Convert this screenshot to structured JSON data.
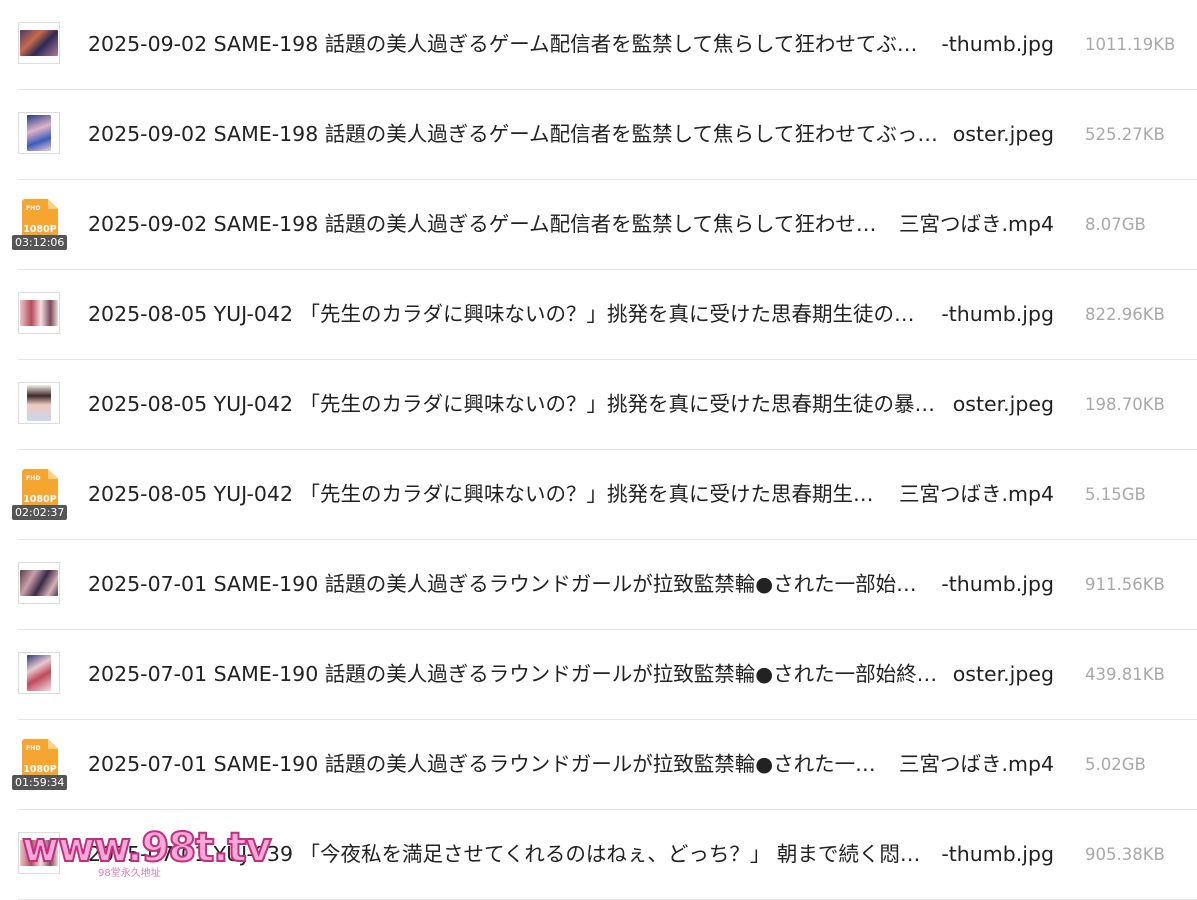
{
  "files": [
    {
      "type": "image",
      "thumb": "a",
      "name": "2025-09-02 SAME-198 話題の美人過ぎるゲーム配信者を監禁して焦らして狂わせてぶ…",
      "suffix": "-thumb.jpg",
      "size": "1011.19KB"
    },
    {
      "type": "image",
      "thumb": "b",
      "name": "2025-09-02 SAME-198 話題の美人過ぎるゲーム配信者を監禁して焦らして狂わせてぶっ…",
      "suffix": "oster.jpeg",
      "size": "525.27KB"
    },
    {
      "type": "video",
      "res": "1080P",
      "fhd": "FHD",
      "duration": "03:12:06",
      "name": "2025-09-02 SAME-198 話題の美人過ぎるゲーム配信者を監禁して焦らして狂わせ…",
      "suffix": "三宮つばき.mp4",
      "size": "8.07GB"
    },
    {
      "type": "image",
      "thumb": "c",
      "name": "2025-08-05 YUJ-042 「先生のカラダに興味ないの？」挑発を真に受けた思春期生徒の…",
      "suffix": "-thumb.jpg",
      "size": "822.96KB"
    },
    {
      "type": "image",
      "thumb": "d",
      "name": "2025-08-05 YUJ-042 「先生のカラダに興味ないの？」挑発を真に受けた思春期生徒の暴…",
      "suffix": "oster.jpeg",
      "size": "198.70KB"
    },
    {
      "type": "video",
      "res": "1080P",
      "fhd": "FHD",
      "duration": "02:02:37",
      "name": "2025-08-05 YUJ-042 「先生のカラダに興味ないの？」挑発を真に受けた思春期生…",
      "suffix": "三宮つばき.mp4",
      "size": "5.15GB"
    },
    {
      "type": "image",
      "thumb": "e",
      "name": "2025-07-01 SAME-190 話題の美人過ぎるラウンドガールが拉致監禁輪●された一部始…",
      "suffix": "-thumb.jpg",
      "size": "911.56KB"
    },
    {
      "type": "image",
      "thumb": "f",
      "name": "2025-07-01 SAME-190 話題の美人過ぎるラウンドガールが拉致監禁輪●された一部始終…",
      "suffix": "oster.jpeg",
      "size": "439.81KB"
    },
    {
      "type": "video",
      "res": "1080P",
      "fhd": "FHD",
      "duration": "01:59:34",
      "name": "2025-07-01 SAME-190 話題の美人過ぎるラウンドガールが拉致監禁輪●された一…",
      "suffix": "三宮つばき.mp4",
      "size": "5.02GB"
    },
    {
      "type": "image",
      "thumb": "c",
      "name": "2025-07-01 YUJ-039 「今夜私を満足させてくれるのはねぇ、どっち？」 朝まで続く悶…",
      "suffix": "-thumb.jpg",
      "size": "905.38KB"
    }
  ],
  "watermark": {
    "text": "www.98t.tv",
    "sub": "98堂永久地址"
  }
}
